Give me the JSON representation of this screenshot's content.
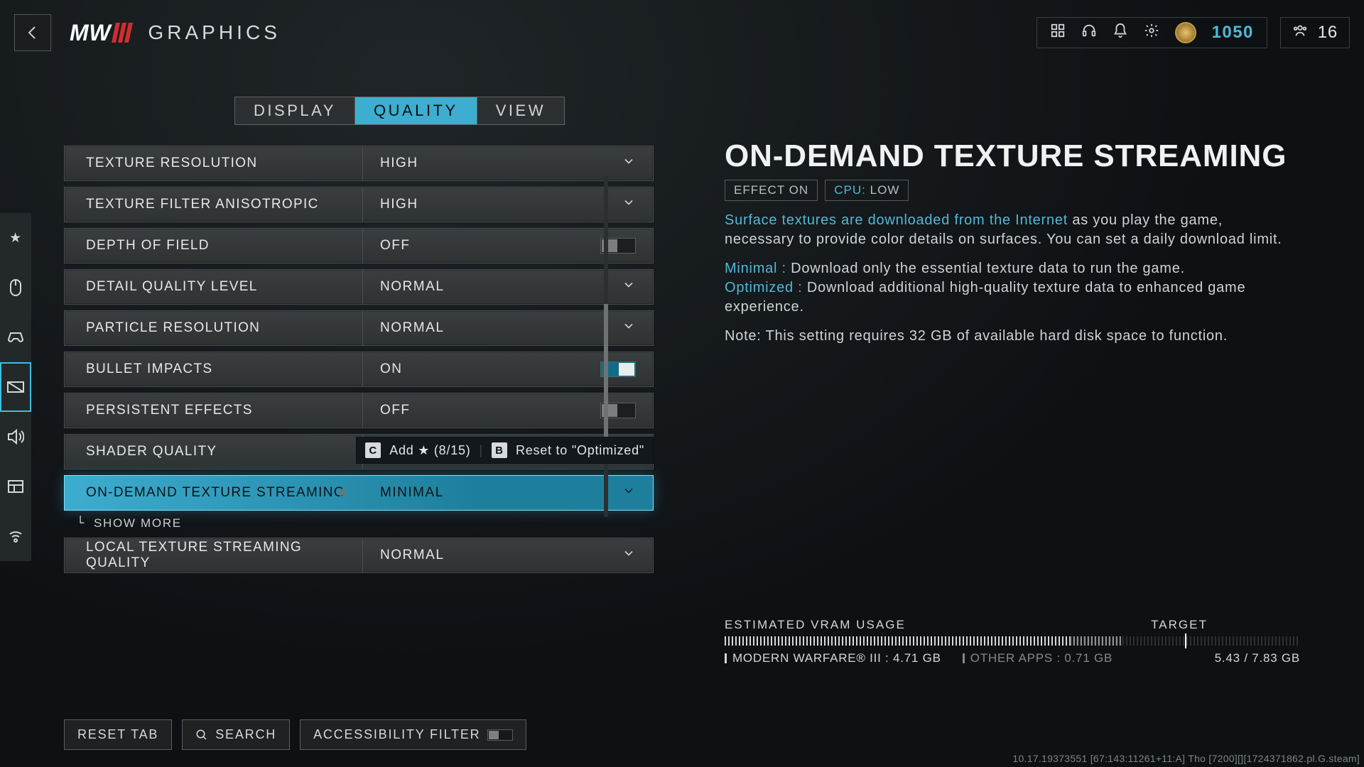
{
  "header": {
    "title": "GRAPHICS",
    "currency": "1050",
    "party_count": "16"
  },
  "tabs": [
    {
      "label": "DISPLAY"
    },
    {
      "label": "QUALITY",
      "active": true
    },
    {
      "label": "VIEW"
    }
  ],
  "hint": {
    "key1": "C",
    "act1": "Add ★ (8/15)",
    "key2": "B",
    "act2": "Reset to \"Optimized\""
  },
  "settings": [
    {
      "label": "TEXTURE RESOLUTION",
      "value": "HIGH",
      "control": "dropdown"
    },
    {
      "label": "TEXTURE FILTER ANISOTROPIC",
      "value": "HIGH",
      "control": "dropdown"
    },
    {
      "label": "DEPTH OF FIELD",
      "value": "OFF",
      "control": "toggle",
      "on": false
    },
    {
      "label": "DETAIL QUALITY LEVEL",
      "value": "NORMAL",
      "control": "dropdown"
    },
    {
      "label": "PARTICLE RESOLUTION",
      "value": "NORMAL",
      "control": "dropdown"
    },
    {
      "label": "BULLET IMPACTS",
      "value": "ON",
      "control": "toggle",
      "on": true
    },
    {
      "label": "PERSISTENT EFFECTS",
      "value": "OFF",
      "control": "toggle",
      "on": false
    },
    {
      "label": "SHADER QUALITY",
      "value": "",
      "control": "dropdown"
    },
    {
      "label": "ON-DEMAND TEXTURE STREAMING",
      "value": "MINIMAL",
      "control": "dropdown",
      "selected": true,
      "favorite": true
    },
    {
      "label": "LOCAL TEXTURE STREAMING QUALITY",
      "value": "NORMAL",
      "control": "dropdown"
    }
  ],
  "showmore": "SHOW MORE",
  "detail": {
    "title": "ON-DEMAND TEXTURE STREAMING",
    "badge1": "EFFECT ON",
    "badge2_a": "CPU:",
    "badge2_b": " LOW",
    "intro_a": "Surface textures are downloaded from the Internet",
    "intro_b": " as you play the game, necessary to provide color details on surfaces. You can set a daily download limit.",
    "min_label": "Minimal :",
    "min_text": " Download only the essential texture data to run the game.",
    "opt_label": "Optimized :",
    "opt_text": " Download additional high-quality texture data to enhanced game experience.",
    "note": "Note: This setting requires 32 GB of available hard disk space to function."
  },
  "vram": {
    "est": "ESTIMATED VRAM USAGE",
    "target": "TARGET",
    "game": "MODERN WARFARE® III : 4.71 GB",
    "other": "OTHER APPS : 0.71 GB",
    "total": "5.43 / 7.83 GB",
    "fill_pct": 60,
    "other_pct": 9,
    "target_pct": 80
  },
  "bottom": {
    "reset": "RESET TAB",
    "search": "SEARCH",
    "access": "ACCESSIBILITY FILTER"
  },
  "build": "10.17.19373551 [67:143:11261+11:A] Tho [7200][][1724371862.pl.G.steam]"
}
